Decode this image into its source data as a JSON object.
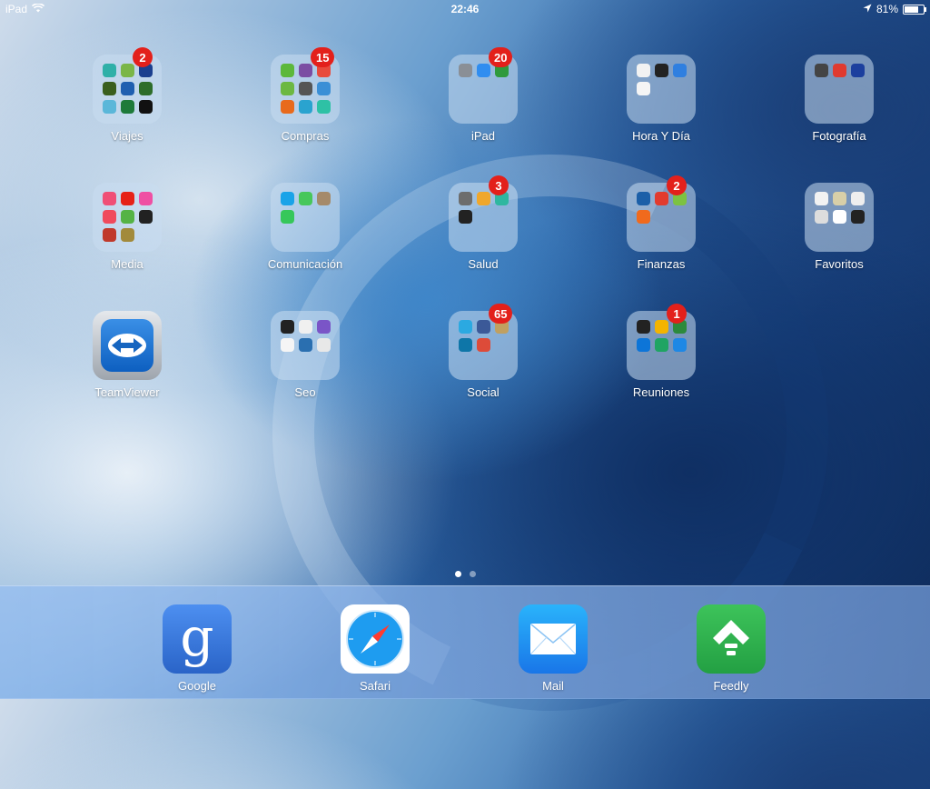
{
  "status_bar": {
    "device": "iPad",
    "time": "22:46",
    "battery": "81%",
    "battery_level": 0.81
  },
  "apps": [
    {
      "label": "Viajes",
      "type": "folder",
      "badge": "2",
      "minis": [
        "#2fb0a8",
        "#7ab648",
        "#1b3f8f",
        "#3a5f1e",
        "#1f5fb0",
        "#2e6d2a",
        "#5bb7d9",
        "#1e7a3a",
        "#111111"
      ]
    },
    {
      "label": "Compras",
      "type": "folder",
      "badge": "15",
      "minis": [
        "#5cb83a",
        "#7b4ea3",
        "#e84b3c",
        "#6cb842",
        "#555555",
        "#3b8fd6",
        "#e86a1c",
        "#2aa3cf",
        "#2ec1a5"
      ]
    },
    {
      "label": "iPad",
      "type": "folder",
      "badge": "20",
      "minis": [
        "#8a8f96",
        "#2f8df0",
        "#2f9a3c"
      ]
    },
    {
      "label": "Hora Y Día",
      "type": "folder",
      "badge": "",
      "minis": [
        "#f2f2f2",
        "#222222",
        "#2f7fe0",
        "#f5f5f5"
      ]
    },
    {
      "label": "Fotografía",
      "type": "folder",
      "badge": "",
      "minis": [
        "#444444",
        "#e03a2f",
        "#1c3f9e"
      ]
    },
    {
      "label": "Media",
      "type": "folder",
      "badge": "",
      "minis": [
        "#f04f76",
        "#e62117",
        "#ef4fa3",
        "#f04a5c",
        "#55b345",
        "#222222",
        "#c0392b",
        "#a28a3b"
      ]
    },
    {
      "label": "Comunicación",
      "type": "folder",
      "badge": "",
      "minis": [
        "#1aa3e8",
        "#47c75a",
        "#a58a6a",
        "#36c75a"
      ]
    },
    {
      "label": "Salud",
      "type": "folder",
      "badge": "3",
      "minis": [
        "#6d6d6d",
        "#f0a72c",
        "#2fb7a0",
        "#222222"
      ]
    },
    {
      "label": "Finanzas",
      "type": "folder",
      "badge": "2",
      "minis": [
        "#1b5fa8",
        "#e23b2e",
        "#7cc242",
        "#f06a1d"
      ]
    },
    {
      "label": "Favoritos",
      "type": "folder",
      "badge": "",
      "minis": [
        "#f2f2f2",
        "#d8cfa8",
        "#eeeeee",
        "#dddddd",
        "#ffffff",
        "#222222"
      ]
    },
    {
      "label": "TeamViewer",
      "type": "app",
      "badge": "",
      "minis": []
    },
    {
      "label": "Seo",
      "type": "folder",
      "badge": "",
      "minis": [
        "#222222",
        "#f0f0f0",
        "#7a55c7",
        "#f5f5f5",
        "#2a6fb0",
        "#e8e8e8"
      ]
    },
    {
      "label": "Social",
      "type": "folder",
      "badge": "65",
      "minis": [
        "#2ba9e1",
        "#3b5998",
        "#c0a060",
        "#0e76a8",
        "#dd4b39"
      ]
    },
    {
      "label": "Reuniones",
      "type": "folder",
      "badge": "1",
      "minis": [
        "#222222",
        "#f4b400",
        "#2c8a3c",
        "#0d75d8",
        "#1fa463",
        "#1e88e5"
      ]
    }
  ],
  "page_dots": [
    true,
    false
  ],
  "dock": [
    {
      "label": "Google",
      "color": "#3d7fe0"
    },
    {
      "label": "Safari",
      "color": "#ffffff"
    },
    {
      "label": "Mail",
      "color": "#1e8df0"
    },
    {
      "label": "Feedly",
      "color": "#2bb24c"
    }
  ]
}
